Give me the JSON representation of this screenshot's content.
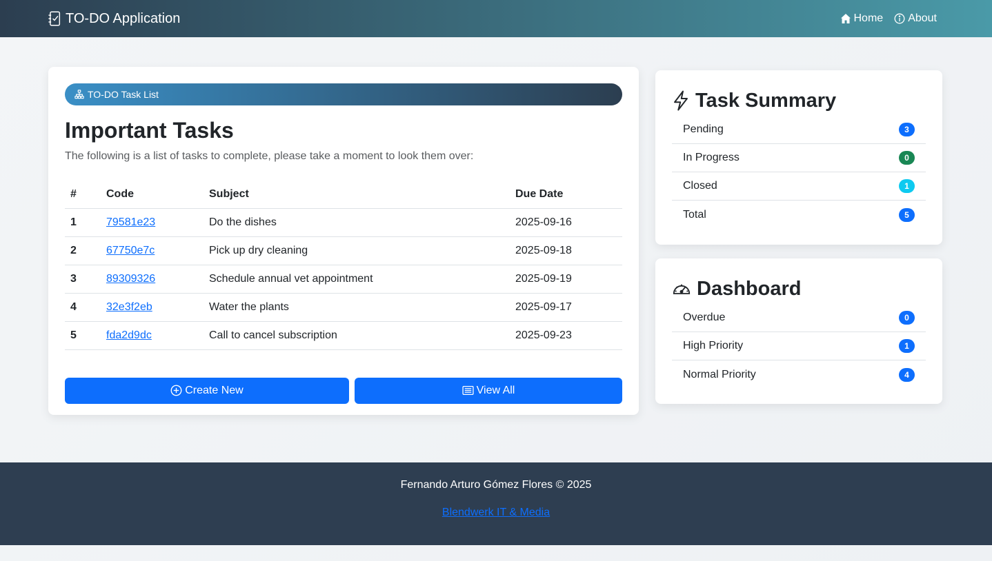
{
  "navbar": {
    "brand": "TO-DO Application",
    "brand_icon": "journal-check-icon",
    "links": [
      {
        "label": "Home",
        "icon": "house-icon"
      },
      {
        "label": "About",
        "icon": "info-circle-icon"
      }
    ]
  },
  "main": {
    "pill_label": "TO-DO Task List",
    "pill_icon": "diagram-icon",
    "title": "Important Tasks",
    "description": "The following is a list of tasks to complete, please take a moment to look them over:",
    "table": {
      "headers": [
        "#",
        "Code",
        "Subject",
        "Due Date"
      ],
      "rows": [
        {
          "num": "1",
          "code": "79581e23",
          "subject": "Do the dishes",
          "due": "2025-09-16"
        },
        {
          "num": "2",
          "code": "67750e7c",
          "subject": "Pick up dry cleaning",
          "due": "2025-09-18"
        },
        {
          "num": "3",
          "code": "89309326",
          "subject": "Schedule annual vet appointment",
          "due": "2025-09-19"
        },
        {
          "num": "4",
          "code": "32e3f2eb",
          "subject": "Water the plants",
          "due": "2025-09-17"
        },
        {
          "num": "5",
          "code": "fda2d9dc",
          "subject": "Call to cancel subscription",
          "due": "2025-09-23"
        }
      ]
    },
    "buttons": {
      "create": "Create New",
      "view_all": "View All"
    }
  },
  "summary": {
    "title": "Task Summary",
    "icon": "lightning-icon",
    "items": [
      {
        "label": "Pending",
        "count": "3",
        "color": "#0d6efd"
      },
      {
        "label": "In Progress",
        "count": "0",
        "color": "#198754"
      },
      {
        "label": "Closed",
        "count": "1",
        "color": "#0dcaf0"
      },
      {
        "label": "Total",
        "count": "5",
        "color": "#0d6efd"
      }
    ]
  },
  "dashboard": {
    "title": "Dashboard",
    "icon": "speedometer-icon",
    "items": [
      {
        "label": "Overdue",
        "count": "0",
        "color": "#0d6efd"
      },
      {
        "label": "High Priority",
        "count": "1",
        "color": "#0d6efd"
      },
      {
        "label": "Normal Priority",
        "count": "4",
        "color": "#0d6efd"
      }
    ]
  },
  "footer": {
    "copyright": "Fernando Arturo Gómez Flores © 2025",
    "link": "Blendwerk IT & Media"
  },
  "colors": {
    "primary": "#0d6efd",
    "success": "#198754",
    "info": "#0dcaf0",
    "footer_bg": "#2e3e51"
  }
}
